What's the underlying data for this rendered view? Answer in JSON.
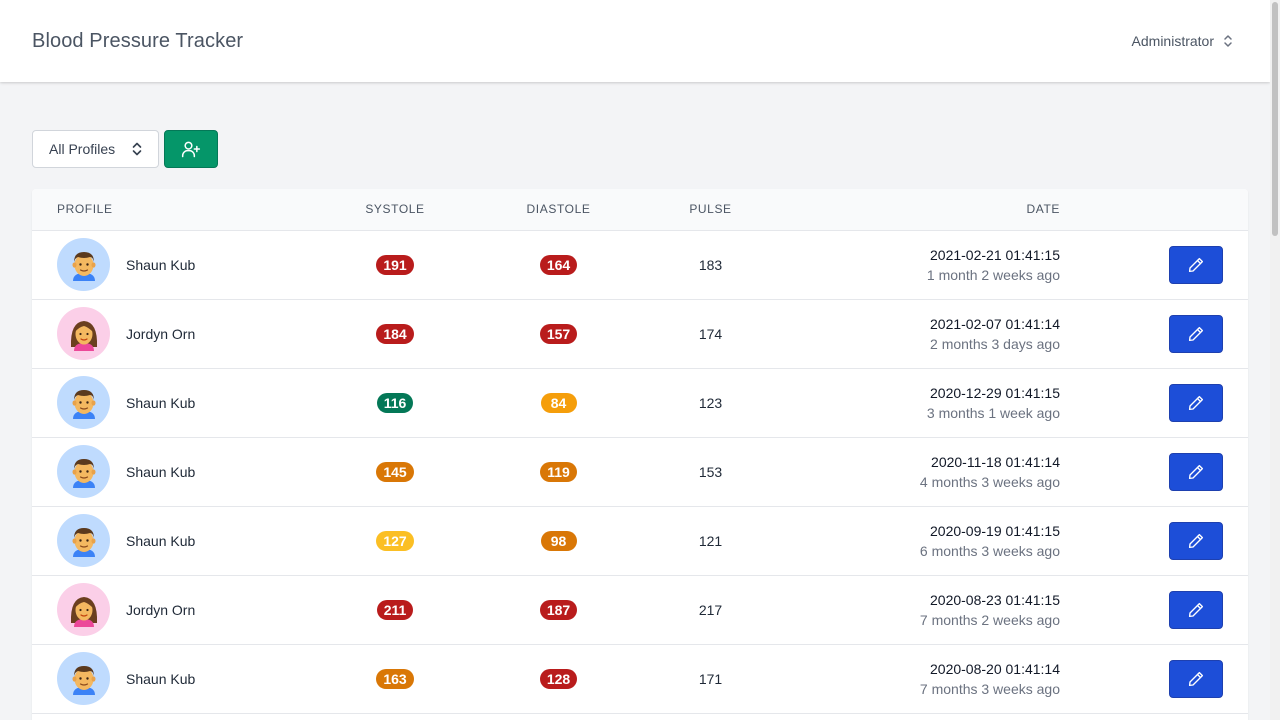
{
  "header": {
    "title": "Blood Pressure Tracker",
    "user_label": "Administrator"
  },
  "filters": {
    "profile_select_value": "All Profiles",
    "add_profile_icon": "user-plus-icon"
  },
  "colors": {
    "critical": "#b91c1c",
    "high": "#d97706",
    "elevated": "#fbbf24",
    "warning": "#f59e0b",
    "normal": "#047857",
    "add_button": "#059669",
    "edit_button": "#1d4ed8"
  },
  "table": {
    "columns": [
      "Profile",
      "Systole",
      "Diastole",
      "Pulse",
      "Date"
    ],
    "rows": [
      {
        "profile": "Shaun Kub",
        "gender": "male",
        "systole": "191",
        "systole_level": "critical",
        "diastole": "164",
        "diastole_level": "critical",
        "pulse": "183",
        "date": "2021-02-21 01:41:15",
        "ago": "1 month 2 weeks ago"
      },
      {
        "profile": "Jordyn Orn",
        "gender": "female",
        "systole": "184",
        "systole_level": "critical",
        "diastole": "157",
        "diastole_level": "critical",
        "pulse": "174",
        "date": "2021-02-07 01:41:14",
        "ago": "2 months 3 days ago"
      },
      {
        "profile": "Shaun Kub",
        "gender": "male",
        "systole": "116",
        "systole_level": "normal",
        "diastole": "84",
        "diastole_level": "warning",
        "pulse": "123",
        "date": "2020-12-29 01:41:15",
        "ago": "3 months 1 week ago"
      },
      {
        "profile": "Shaun Kub",
        "gender": "male",
        "systole": "145",
        "systole_level": "high",
        "diastole": "119",
        "diastole_level": "high",
        "pulse": "153",
        "date": "2020-11-18 01:41:14",
        "ago": "4 months 3 weeks ago"
      },
      {
        "profile": "Shaun Kub",
        "gender": "male",
        "systole": "127",
        "systole_level": "elevated",
        "diastole": "98",
        "diastole_level": "high",
        "pulse": "121",
        "date": "2020-09-19 01:41:15",
        "ago": "6 months 3 weeks ago"
      },
      {
        "profile": "Jordyn Orn",
        "gender": "female",
        "systole": "211",
        "systole_level": "critical",
        "diastole": "187",
        "diastole_level": "critical",
        "pulse": "217",
        "date": "2020-08-23 01:41:15",
        "ago": "7 months 2 weeks ago"
      },
      {
        "profile": "Shaun Kub",
        "gender": "male",
        "systole": "163",
        "systole_level": "high",
        "diastole": "128",
        "diastole_level": "critical",
        "pulse": "171",
        "date": "2020-08-20 01:41:14",
        "ago": "7 months 3 weeks ago"
      }
    ],
    "edit_icon": "pencil-icon"
  }
}
